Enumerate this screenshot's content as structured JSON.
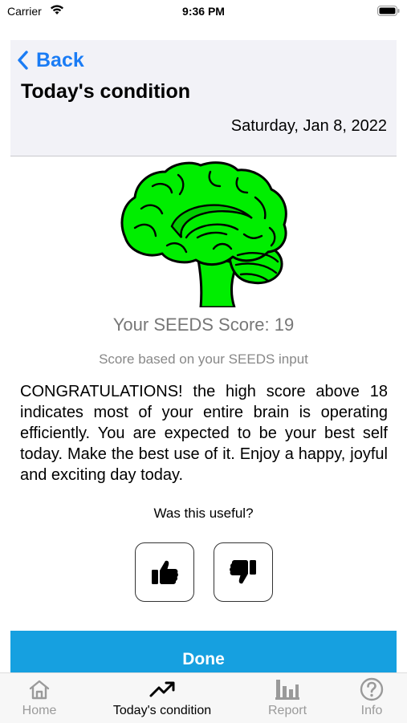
{
  "status_bar": {
    "carrier": "Carrier",
    "time": "9:36 PM"
  },
  "header": {
    "back_label": "Back",
    "title": "Today's condition",
    "date": "Saturday, Jan 8, 2022"
  },
  "brain": {
    "icon": "brain-icon",
    "color": "#00ee00"
  },
  "score": {
    "label": "Your SEEDS Score: 19",
    "subtitle": "Score based on your SEEDS input"
  },
  "message": "CONGRATULATIONS! the high score above 18 indicates most of your entire brain is operating efficiently. You are expected to be your best self today. Make the best use of it. Enjoy a happy, joyful and exciting day today.",
  "feedback": {
    "question": "Was this useful?",
    "up_icon": "thumbs-up-icon",
    "down_icon": "thumbs-down-icon"
  },
  "done_label": "Done",
  "tabs": [
    {
      "label": "Home",
      "icon": "home-icon",
      "active": false
    },
    {
      "label": "Today's condition",
      "icon": "trend-icon",
      "active": true
    },
    {
      "label": "Report",
      "icon": "bar-chart-icon",
      "active": false
    },
    {
      "label": "Info",
      "icon": "question-icon",
      "active": false
    }
  ],
  "colors": {
    "accent": "#1a7cf5",
    "done_button": "#16a0e0",
    "brain": "#00ee00"
  }
}
